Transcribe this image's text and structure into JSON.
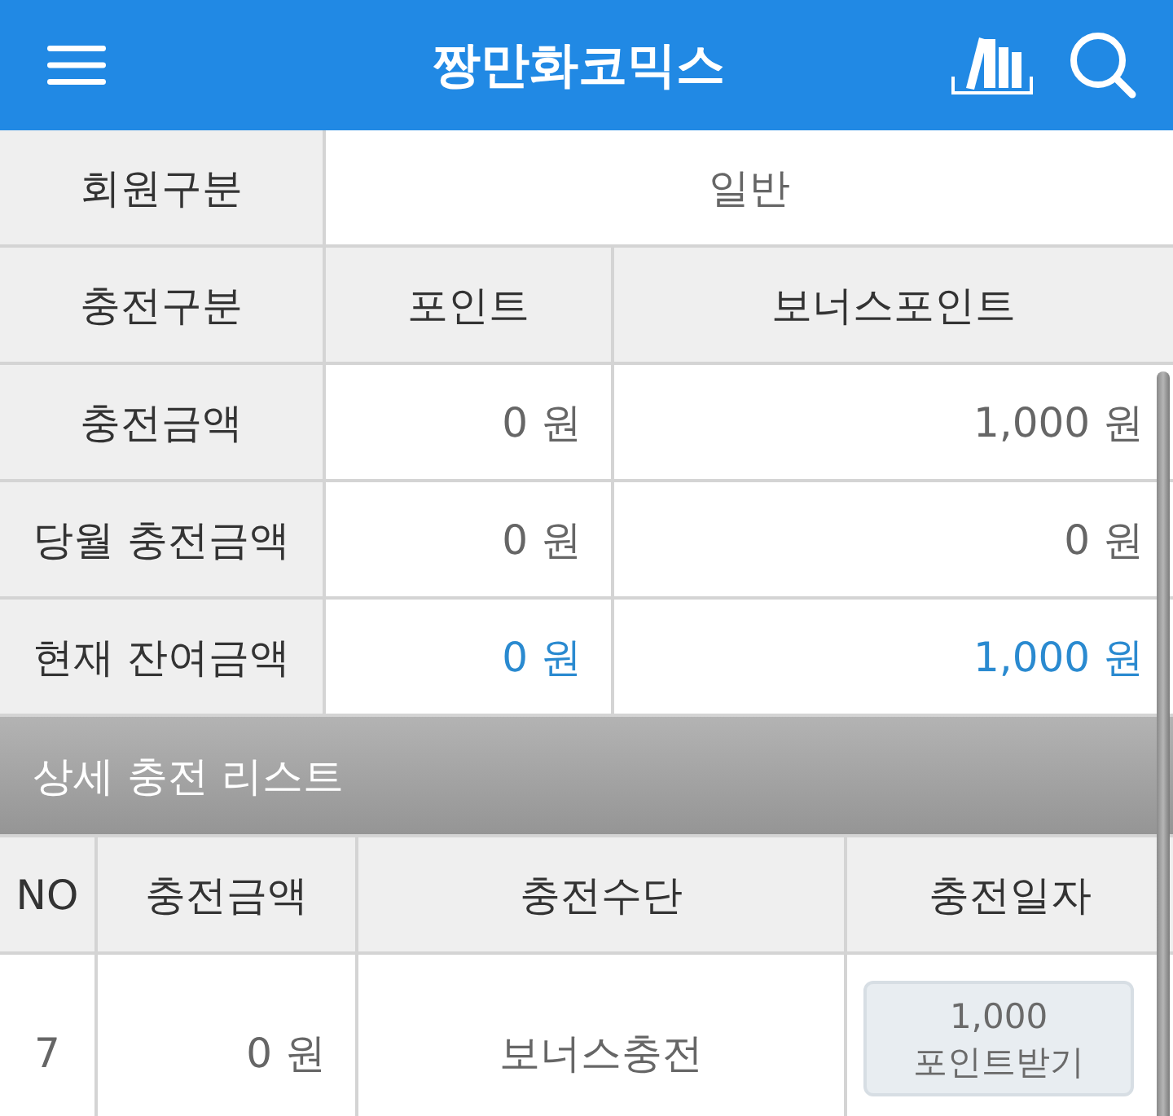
{
  "header": {
    "title": "짱만화코믹스"
  },
  "member_type": {
    "label": "회원구분",
    "value": "일반"
  },
  "charge_table": {
    "label": "충전구분",
    "columns": [
      "포인트",
      "보너스포인트"
    ],
    "rows": [
      {
        "label": "충전금액",
        "values": [
          "0 원",
          "1,000 원"
        ],
        "highlighted": false
      },
      {
        "label": "당월 충전금액",
        "values": [
          "0 원",
          "0 원"
        ],
        "highlighted": false
      },
      {
        "label": "현재 잔여금액",
        "values": [
          "0 원",
          "1,000 원"
        ],
        "highlighted": true
      }
    ]
  },
  "detail_list": {
    "title": "상세 충전 리스트",
    "columns": [
      "NO",
      "충전금액",
      "충전수단",
      "충전일자"
    ],
    "rows": [
      {
        "no": "7",
        "amount": "0 원",
        "method": "보너스충전",
        "action": "1,000 포인트받기"
      }
    ]
  }
}
